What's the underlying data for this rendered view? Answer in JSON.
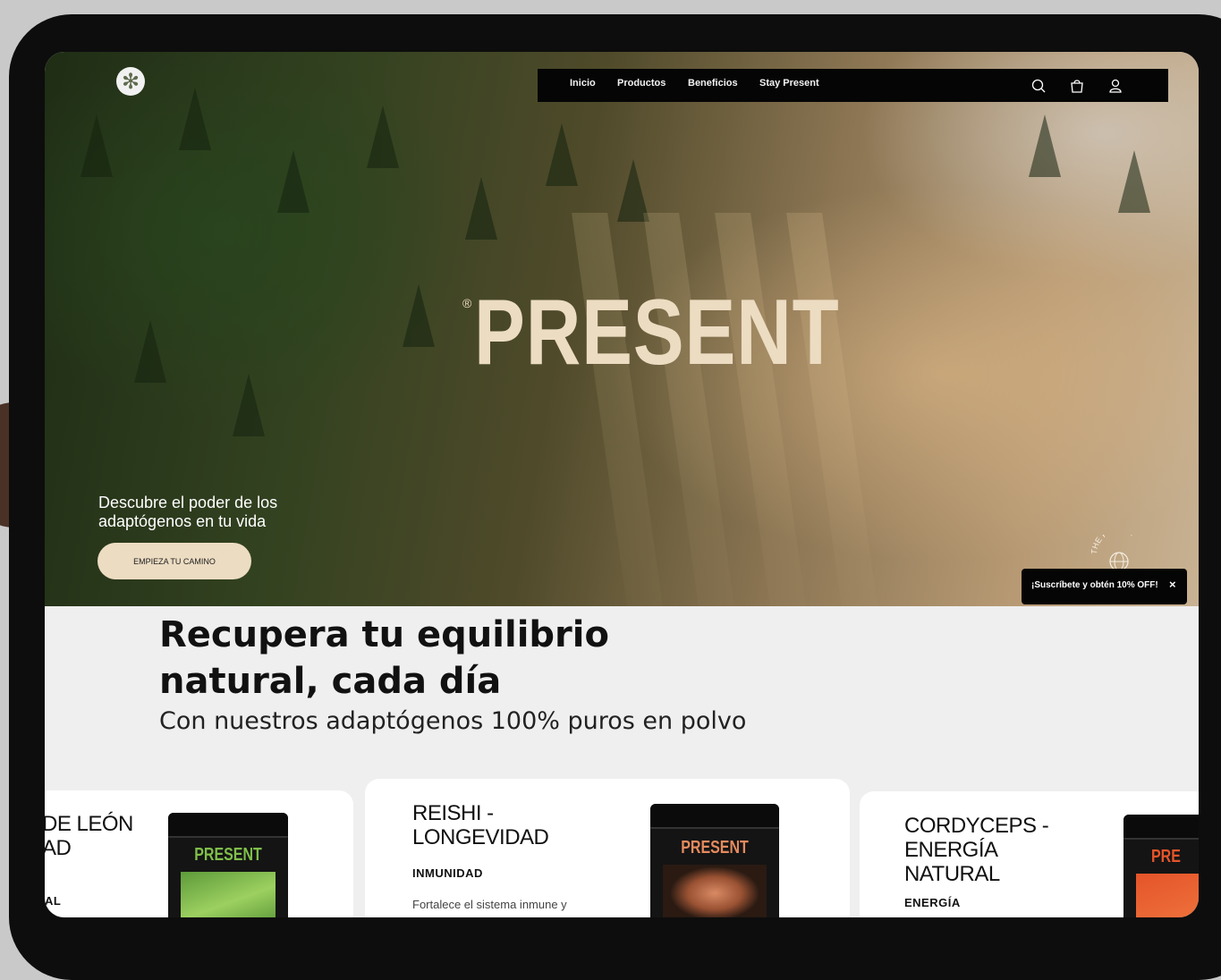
{
  "nav": {
    "items": [
      "Inicio",
      "Productos",
      "Beneficios",
      "Stay Present"
    ],
    "icons": [
      "search-icon",
      "cart-icon",
      "user-icon"
    ]
  },
  "hero": {
    "brand": "PRESENT",
    "brand_mark": "®",
    "tagline": "Descubre el poder de los adaptógenos en tu vida",
    "cta": "EMPIEZA TU CAMINO",
    "badge_text": "THE POWER"
  },
  "promo": {
    "text": "¡Suscríbete y obtén 10% OFF!",
    "close": "×"
  },
  "section": {
    "title": "Recupera tu equilibrio natural, cada día",
    "subtitle": "Con nuestros adaptógenos 100% puros en polvo"
  },
  "products": [
    {
      "title": "DE LEÓN\nAD",
      "category": "AL",
      "jar_label": "PRESENT",
      "label_color": "#7fbf4a"
    },
    {
      "title": "REISHI -\nLONGEVIDAD",
      "category": "INMUNIDAD",
      "description": "Fortalece el sistema inmune y",
      "jar_label": "PRESENT",
      "label_color": "#e58a5e"
    },
    {
      "title": "CORDYCEPS -\nENERGÍA\nNATURAL",
      "category": "ENERGÍA",
      "jar_label": "PRE",
      "label_color": "#e5542a"
    }
  ],
  "colors": {
    "cream": "#ecdcc2",
    "black": "#050505",
    "page_bg": "#efefef"
  }
}
